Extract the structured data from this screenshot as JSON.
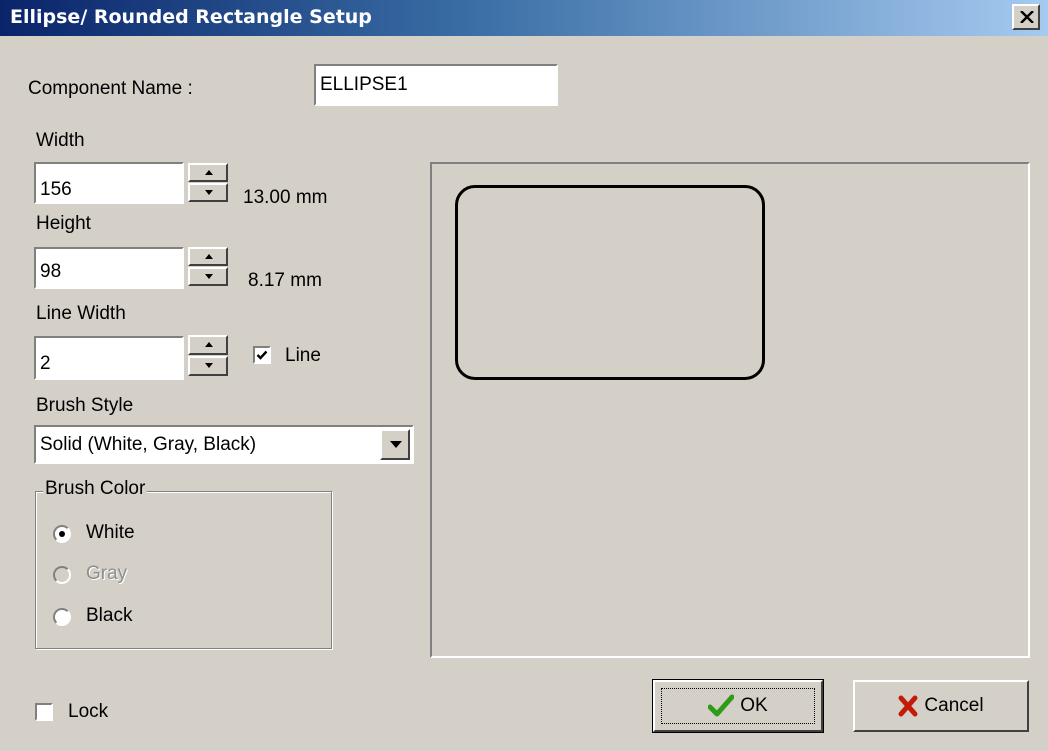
{
  "window": {
    "title": "Ellipse/ Rounded Rectangle Setup",
    "close_label": "close"
  },
  "component_name": {
    "label": "Component Name :",
    "value": "ELLIPSE1"
  },
  "width": {
    "label": "Width",
    "value": "156",
    "unit_text": "13.00 mm"
  },
  "height": {
    "label": "Height",
    "value": "98",
    "unit_text": "8.17 mm"
  },
  "line_width": {
    "label": "Line Width",
    "value": "2"
  },
  "line_checkbox": {
    "label": "Line",
    "checked": true
  },
  "brush_style": {
    "label": "Brush Style",
    "selected": "Solid (White, Gray, Black)"
  },
  "brush_color": {
    "legend": "Brush Color",
    "options": [
      {
        "label": "White",
        "selected": true,
        "disabled": false
      },
      {
        "label": "Gray",
        "selected": false,
        "disabled": true
      },
      {
        "label": "Black",
        "selected": false,
        "disabled": false
      }
    ]
  },
  "preview": {
    "shape": "rounded-rectangle"
  },
  "lock": {
    "label": "Lock",
    "checked": false
  },
  "buttons": {
    "ok_label": "OK",
    "cancel_label": "Cancel"
  },
  "colors": {
    "face": "#d4d0c8",
    "title_start": "#0a246a",
    "title_end": "#a6caf0",
    "ok_icon": "#2e9b1a",
    "cancel_icon": "#c41a0a",
    "disabled_text": "#8e8e8e"
  },
  "icons": {
    "close": "close-x-icon",
    "ok": "checkmark-icon",
    "cancel": "x-cross-icon"
  }
}
